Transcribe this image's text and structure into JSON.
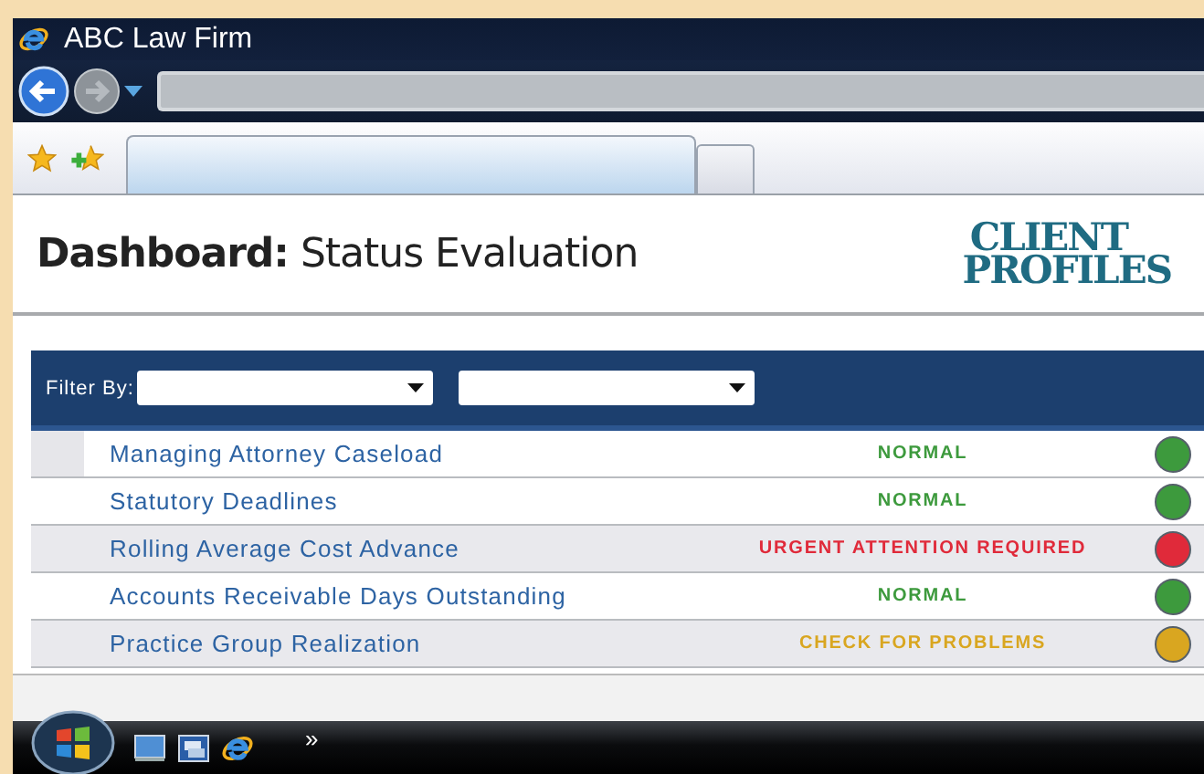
{
  "window": {
    "title": "ABC Law Firm"
  },
  "page": {
    "title": "**Dashboard:** Status Evaluation",
    "logo": {
      "top": "CLIENT",
      "bottom": "PROFILES"
    }
  },
  "filter": {
    "label": "Filter By:"
  },
  "rows": [
    {
      "name": "Managing Attorney Caseload",
      "status": "NORMAL",
      "color": "#3d9a3d",
      "selected": true,
      "shaded": false
    },
    {
      "name": "Statutory Deadlines",
      "status": "NORMAL",
      "color": "#3d9a3d",
      "selected": false,
      "shaded": false
    },
    {
      "name": "Rolling Average Cost Advance",
      "status": "URGENT ATTENTION REQUIRED",
      "color": "#e02a3a",
      "selected": false,
      "shaded": true
    },
    {
      "name": "Accounts Receivable Days Outstanding",
      "status": "NORMAL",
      "color": "#3d9a3d",
      "selected": false,
      "shaded": false
    },
    {
      "name": "Practice Group Realization",
      "status": "CHECK FOR PROBLEMS",
      "color": "#d9a620",
      "selected": false,
      "shaded": true
    }
  ],
  "taskbar": {
    "more": "»"
  }
}
